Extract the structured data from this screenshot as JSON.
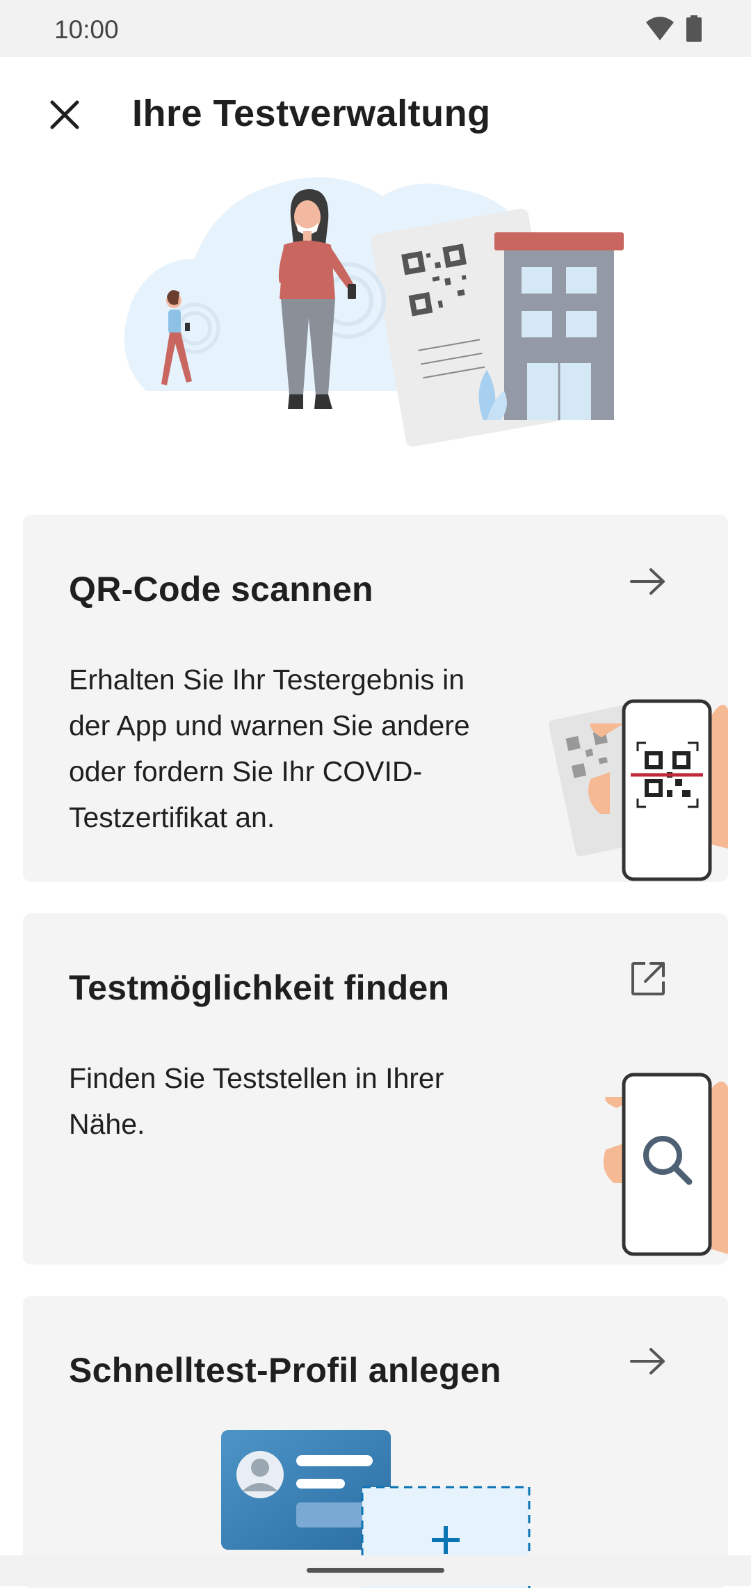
{
  "status_bar": {
    "time": "10:00"
  },
  "header": {
    "title": "Ihre Testverwaltung"
  },
  "cards": [
    {
      "title": "QR-Code scannen",
      "body": "Erhalten Sie Ihr Testergebnis in der App und warnen Sie andere oder fordern Sie Ihr COVID-Testzertifikat an.",
      "action_icon": "arrow-right-icon"
    },
    {
      "title": "Testmöglichkeit finden",
      "body": "Finden Sie Teststellen in Ihrer Nähe.",
      "action_icon": "open-external-icon"
    },
    {
      "title": "Schnelltest-Profil anlegen",
      "body": "",
      "action_icon": "arrow-right-icon"
    }
  ],
  "colors": {
    "card_background": "#f4f4f4",
    "accent": "#0b74b3",
    "building_roof": "#c8665f"
  }
}
